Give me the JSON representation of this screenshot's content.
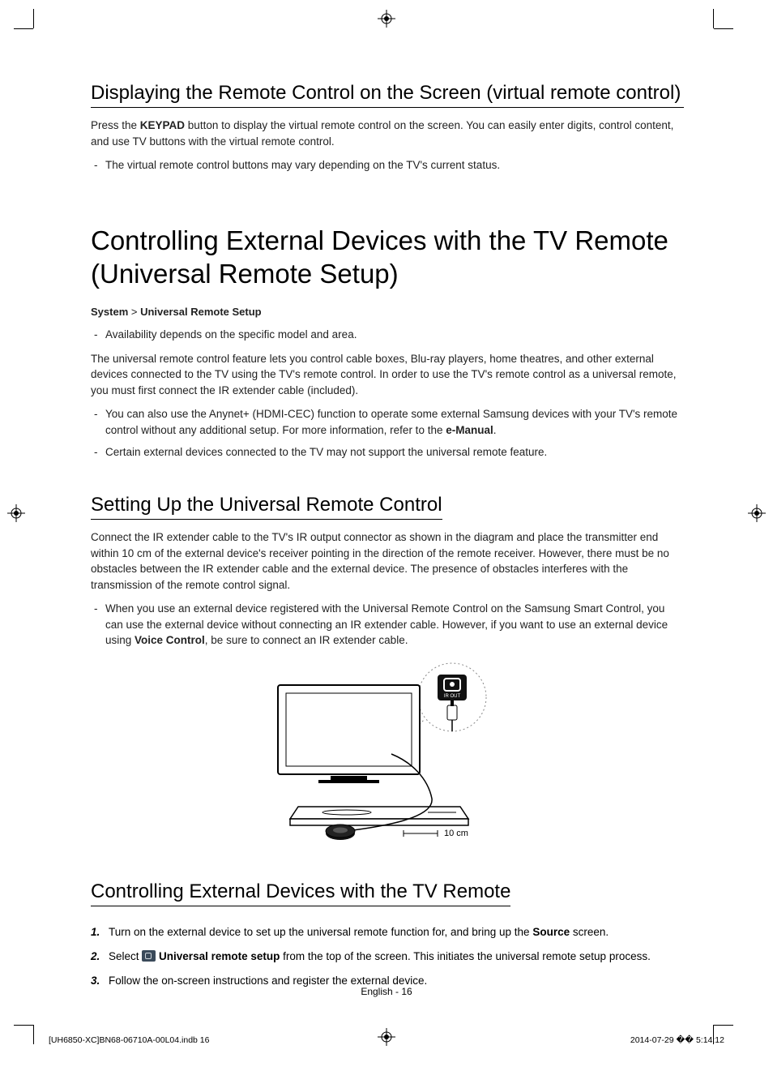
{
  "section1": {
    "heading": "Displaying the Remote Control on the Screen (virtual remote control)",
    "p1_a": "Press the ",
    "p1_b": "KEYPAD",
    "p1_c": " button to display the virtual remote control on the screen. You can easily enter digits, control content, and use TV buttons with the virtual remote control.",
    "note1": "The virtual remote control buttons may vary depending on the TV's current status."
  },
  "section2": {
    "title": "Controlling External Devices with the TV Remote (Universal Remote Setup)",
    "breadcrumb_a": "System",
    "breadcrumb_sep": " > ",
    "breadcrumb_b": "Universal Remote Setup",
    "note1": "Availability depends on the specific model and area.",
    "p1": "The universal remote control feature lets you control cable boxes, Blu-ray players, home theatres, and other external devices connected to the TV using the TV's remote control. In order to use the TV's remote control as a universal remote, you must first connect the IR extender cable (included).",
    "note2_a": "You can also use the Anynet+ (HDMI-CEC) function to operate some external Samsung devices with your TV's remote control without any additional setup. For more information, refer to the ",
    "note2_b": "e-Manual",
    "note2_c": ".",
    "note3": "Certain external devices connected to the TV may not support the universal remote feature."
  },
  "section3": {
    "heading": "Setting Up the Universal Remote Control",
    "p1": "Connect the IR extender cable to the TV's IR output connector as shown in the diagram and place the transmitter end within 10 cm of the external device's receiver pointing in the direction of the remote receiver. However, there must be no obstacles between the IR extender cable and the external device. The presence of obstacles interferes with the transmission of the remote control signal.",
    "note1_a": "When you use an external device registered with the Universal Remote Control on the Samsung Smart Control, you can use the external device without connecting an IR extender cable. However, if you want to use an external device using ",
    "note1_b": "Voice Control",
    "note1_c": ", be sure to connect an IR extender cable.",
    "diagram": {
      "ir_out": "IR OUT",
      "distance": "10 cm"
    }
  },
  "section4": {
    "heading": "Controlling External Devices with the TV Remote",
    "step1_a": "Turn on the external device to set up the universal remote function for, and bring up the ",
    "step1_b": "Source",
    "step1_c": " screen.",
    "step2_a": "Select ",
    "step2_b": "Universal remote setup",
    "step2_c": " from the top of the screen. This initiates the universal remote setup process.",
    "step3": "Follow the on-screen instructions and register the external device."
  },
  "footer": {
    "center": "English - 16",
    "left": "[UH6850-XC]BN68-06710A-00L04.indb   16",
    "right": "2014-07-29   �� 5:14:12"
  }
}
